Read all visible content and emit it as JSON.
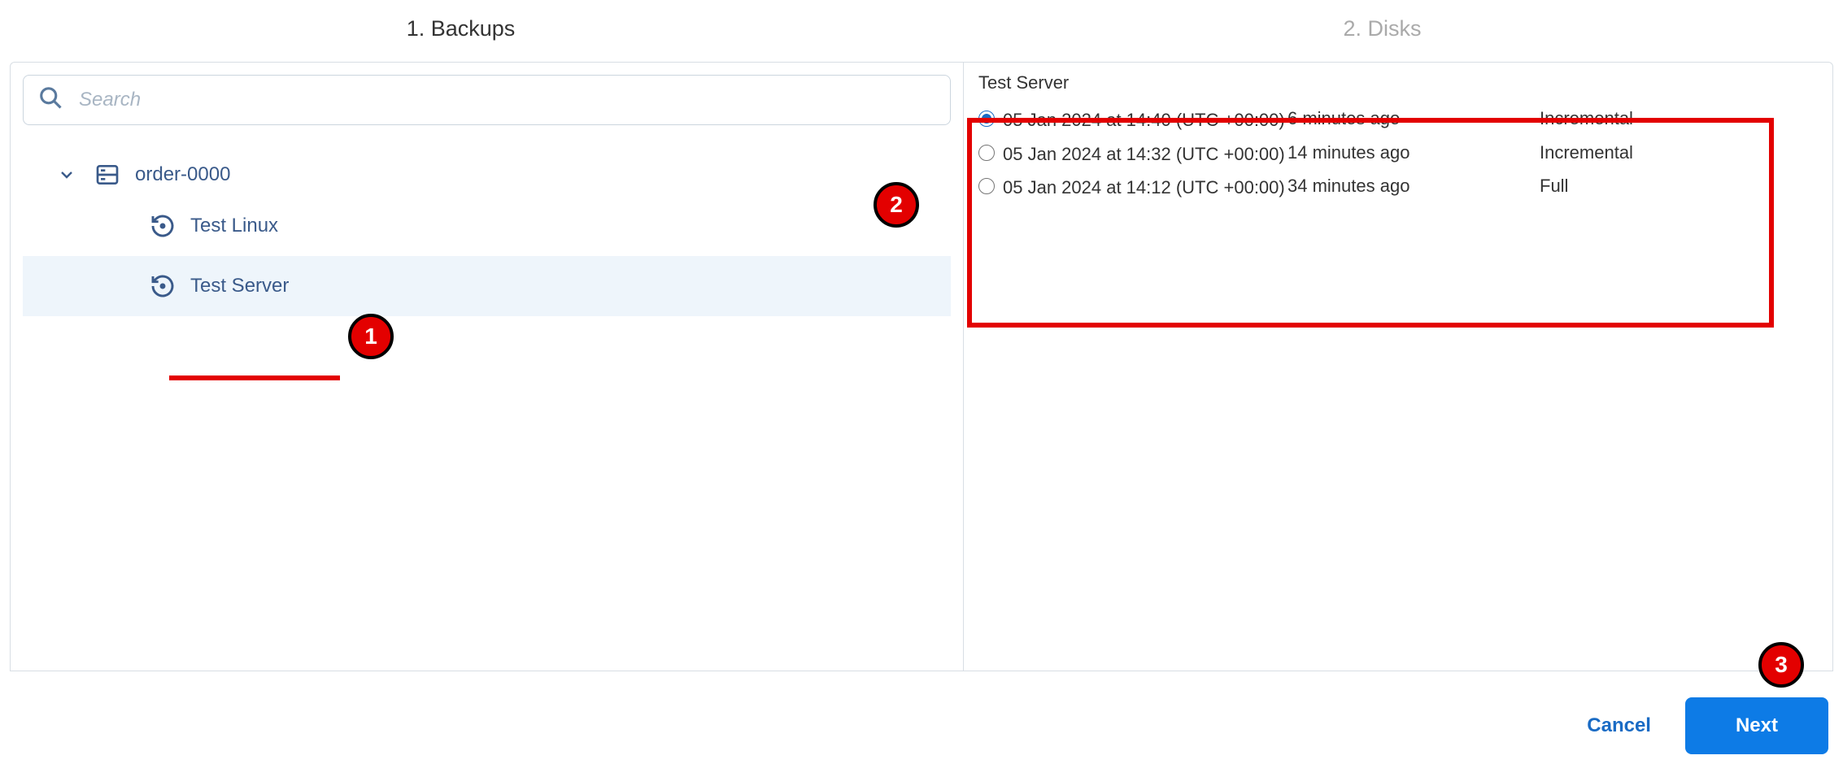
{
  "wizard": {
    "step1": "1. Backups",
    "step2": "2. Disks"
  },
  "search": {
    "placeholder": "Search",
    "value": ""
  },
  "tree": {
    "parent": {
      "label": "order-0000"
    },
    "children": [
      {
        "label": "Test Linux",
        "selected": false
      },
      {
        "label": "Test Server",
        "selected": true
      }
    ]
  },
  "details": {
    "title": "Test Server",
    "backups": [
      {
        "datetime": "05 Jan 2024 at 14:40 (UTC +00:00)",
        "ago": "6 minutes ago",
        "type": "Incremental",
        "selected": true
      },
      {
        "datetime": "05 Jan 2024 at 14:32 (UTC +00:00)",
        "ago": "14 minutes ago",
        "type": "Incremental",
        "selected": false
      },
      {
        "datetime": "05 Jan 2024 at 14:12 (UTC +00:00)",
        "ago": "34 minutes ago",
        "type": "Full",
        "selected": false
      }
    ]
  },
  "footer": {
    "cancel": "Cancel",
    "next": "Next"
  },
  "annotations": {
    "badge1": "1",
    "badge2": "2",
    "badge3": "3"
  }
}
